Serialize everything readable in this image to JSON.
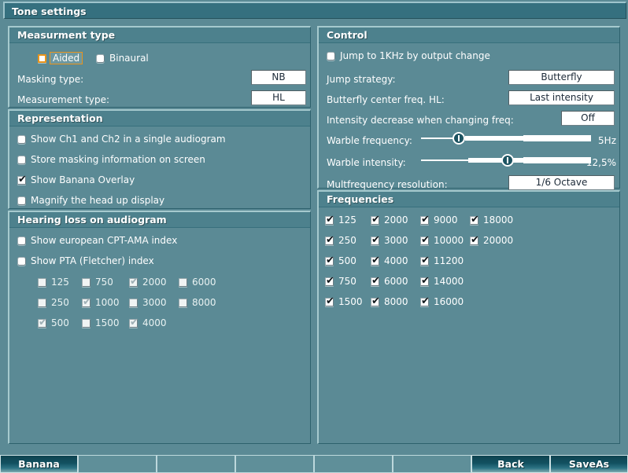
{
  "window": {
    "title": "Tone settings"
  },
  "measurement_type": {
    "title": "Measurment type",
    "aided": {
      "label": "Aided",
      "checked": false,
      "focused": true,
      "tick": ""
    },
    "binaural": {
      "label": "Binaural",
      "checked": false,
      "tick": ""
    },
    "masking_type": {
      "label": "Masking type:",
      "value": "NB"
    },
    "measurement_type": {
      "label": "Measurement type:",
      "value": "HL"
    }
  },
  "representation": {
    "title": "Representation",
    "items": [
      {
        "label": "Show Ch1 and Ch2 in a single audiogram",
        "tick": ""
      },
      {
        "label": "Store masking information on screen",
        "tick": ""
      },
      {
        "label": "Show Banana Overlay",
        "tick": "✔"
      },
      {
        "label": "Magnify the head up display",
        "tick": ""
      }
    ]
  },
  "hearing_loss": {
    "title": "Hearing loss on audiogram",
    "cpt_ama": {
      "label": "Show european CPT-AMA index",
      "tick": ""
    },
    "pta": {
      "label": "Show PTA (Fletcher) index",
      "tick": ""
    },
    "pta_freqs": [
      {
        "label": "125",
        "tick": ""
      },
      {
        "label": "750",
        "tick": ""
      },
      {
        "label": "2000",
        "tick": "✔"
      },
      {
        "label": "6000",
        "tick": ""
      },
      {
        "label": "250",
        "tick": ""
      },
      {
        "label": "1000",
        "tick": "✔"
      },
      {
        "label": "3000",
        "tick": ""
      },
      {
        "label": "8000",
        "tick": ""
      },
      {
        "label": "500",
        "tick": "✔"
      },
      {
        "label": "1500",
        "tick": ""
      },
      {
        "label": "4000",
        "tick": "✔"
      }
    ]
  },
  "control": {
    "title": "Control",
    "jump_1khz": {
      "label": "Jump to 1KHz by output change",
      "tick": ""
    },
    "jump_strategy": {
      "label": "Jump strategy:",
      "value": "Butterfly"
    },
    "butterfly_center": {
      "label": "Butterfly center freq. HL:",
      "value": "Last intensity"
    },
    "intensity_decrease": {
      "label": "Intensity decrease when changing freq:",
      "value": "Off"
    },
    "warble_frequency": {
      "label": "Warble frequency:",
      "value": "5Hz",
      "percent": 22
    },
    "warble_intensity": {
      "label": "Warble intensity:",
      "value": "12,5%",
      "percent": 50
    },
    "multifreq_resolution": {
      "label": "Multfrequency resolution:",
      "value": "1/6 Octave"
    }
  },
  "frequencies": {
    "title": "Frequencies",
    "items": [
      {
        "label": "125",
        "tick": "✔"
      },
      {
        "label": "2000",
        "tick": "✔"
      },
      {
        "label": "9000",
        "tick": "✔"
      },
      {
        "label": "18000",
        "tick": "✔"
      },
      {
        "label": "250",
        "tick": "✔"
      },
      {
        "label": "3000",
        "tick": "✔"
      },
      {
        "label": "10000",
        "tick": "✔"
      },
      {
        "label": "20000",
        "tick": "✔"
      },
      {
        "label": "500",
        "tick": "✔"
      },
      {
        "label": "4000",
        "tick": "✔"
      },
      {
        "label": "11200",
        "tick": "✔"
      },
      {
        "label": "",
        "tick": ""
      },
      {
        "label": "750",
        "tick": "✔"
      },
      {
        "label": "6000",
        "tick": "✔"
      },
      {
        "label": "14000",
        "tick": "✔"
      },
      {
        "label": "",
        "tick": ""
      },
      {
        "label": "1500",
        "tick": "✔"
      },
      {
        "label": "8000",
        "tick": "✔"
      },
      {
        "label": "16000",
        "tick": "✔"
      },
      {
        "label": "",
        "tick": ""
      }
    ]
  },
  "buttons": [
    {
      "label": "Banana",
      "active": true
    },
    {
      "label": "",
      "active": false
    },
    {
      "label": "",
      "active": false
    },
    {
      "label": "",
      "active": false
    },
    {
      "label": "",
      "active": false
    },
    {
      "label": "",
      "active": false
    },
    {
      "label": "Back",
      "active": true
    },
    {
      "label": "SaveAs",
      "active": true
    }
  ],
  "colors": {
    "background": "#5b8a95",
    "panel_header": "#4d818d",
    "accent_focus": "#e8941c",
    "button_active_dark": "#0e4350",
    "field_text": "#1c2a38"
  }
}
